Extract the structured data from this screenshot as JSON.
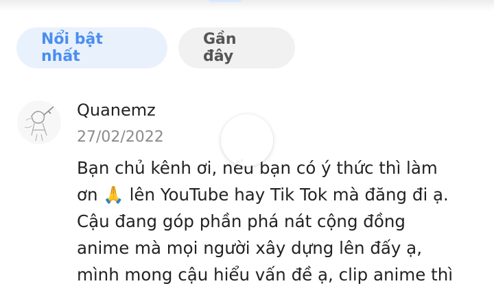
{
  "tabs": {
    "featured_label": "Nổi bật nhất",
    "recent_label": "Gần đây"
  },
  "comment": {
    "username": "Quanemz",
    "date": "27/02/2022",
    "lines": [
      "Bạn chủ kênh ơi, nếu bạn có ý thức thì làm",
      "ơn 🙏 lên YouTube hay Tik Tok mà đăng đi ạ.",
      "Cậu đang góp phần phá nát cộng đồng",
      "anime mà mọi người xây dựng lên đấy ạ,",
      "mình mong cậu hiểu vấn đề ạ, clip anime thì"
    ]
  },
  "colors": {
    "active_tab_bg": "#e9f1fd",
    "active_tab_text": "#4a8ef0",
    "inactive_tab_bg": "#f1f1f1",
    "date_text": "#8a8a8a"
  }
}
